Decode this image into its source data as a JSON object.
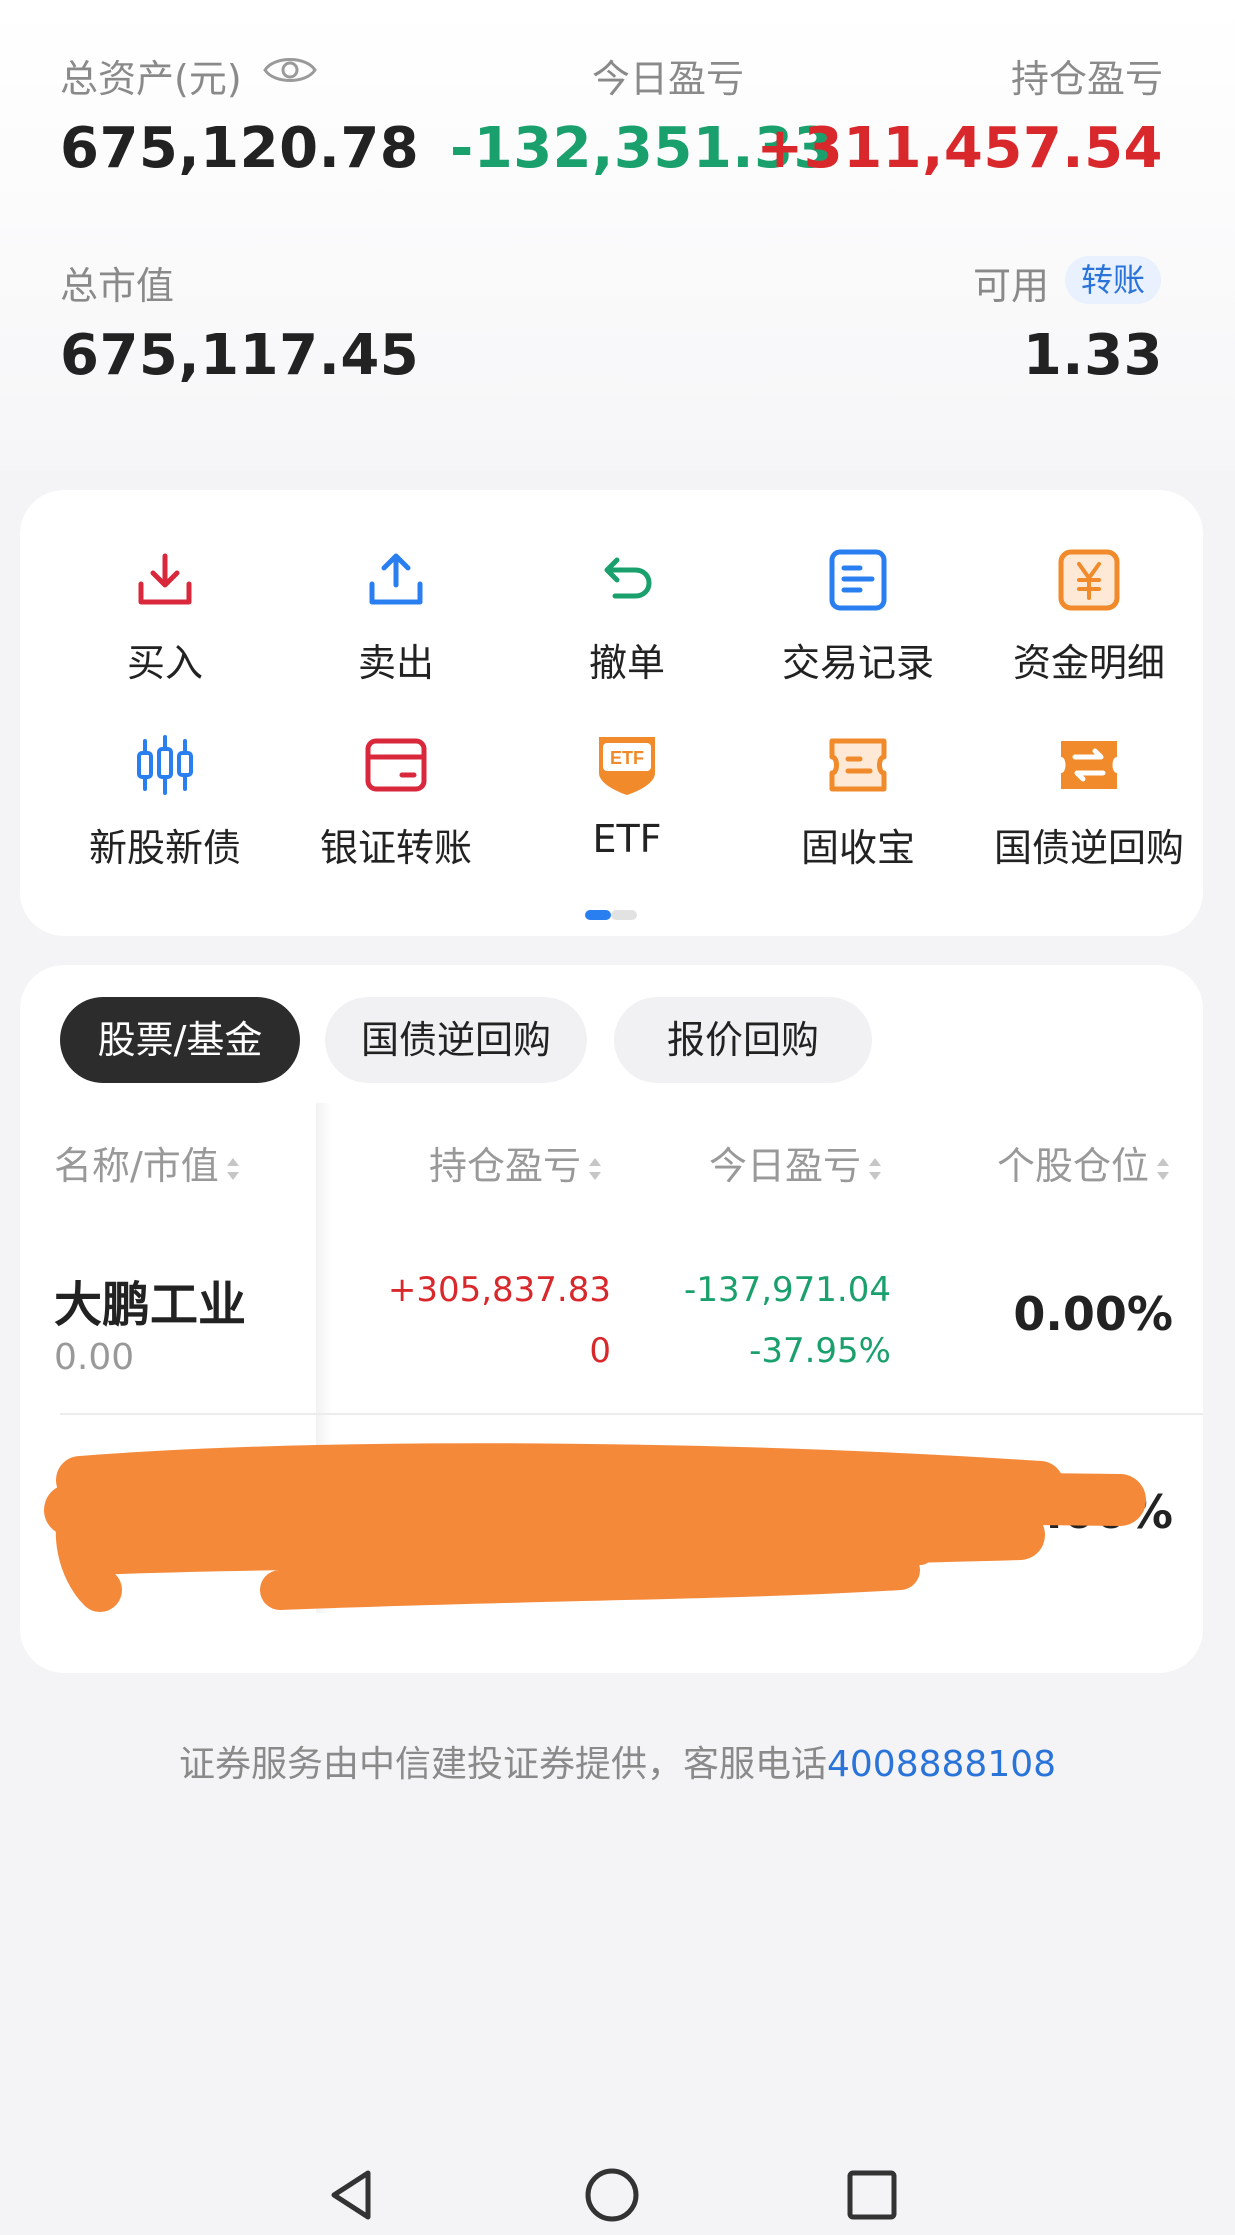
{
  "summary": {
    "total_assets_label": "总资产(元)",
    "total_assets_value": "675,120.78",
    "today_pl_label": "今日盈亏",
    "today_pl_value": "-132,351.33",
    "position_pl_label": "持仓盈亏",
    "position_pl_value": "+311,457.54",
    "market_value_label": "总市值",
    "market_value_value": "675,117.45",
    "available_label": "可用",
    "transfer_tag": "转账",
    "available_value": "1.33"
  },
  "actions": [
    {
      "label": "买入",
      "icon": "buy-download-icon",
      "color": "#d9283c"
    },
    {
      "label": "卖出",
      "icon": "sell-upload-icon",
      "color": "#2a7ff0"
    },
    {
      "label": "撤单",
      "icon": "undo-arrow-icon",
      "color": "#1aa06d"
    },
    {
      "label": "交易记录",
      "icon": "document-icon",
      "color": "#2a7ff0"
    },
    {
      "label": "资金明细",
      "icon": "yuan-icon",
      "color": "#f08a2a"
    },
    {
      "label": "新股新债",
      "icon": "candlestick-icon",
      "color": "#2a7ff0"
    },
    {
      "label": "银证转账",
      "icon": "card-icon",
      "color": "#d9283c"
    },
    {
      "label": "ETF",
      "icon": "etf-shield-icon",
      "color": "#f08a2a"
    },
    {
      "label": "固收宝",
      "icon": "ticket-icon",
      "color": "#f08a2a"
    },
    {
      "label": "国债逆回购",
      "icon": "exchange-icon",
      "color": "#f08a2a"
    }
  ],
  "tabs": [
    {
      "label": "股票/基金",
      "active": true
    },
    {
      "label": "国债逆回购",
      "active": false
    },
    {
      "label": "报价回购",
      "active": false
    }
  ],
  "table": {
    "headers": [
      "名称/市值",
      "持仓盈亏",
      "今日盈亏",
      "个股仓位"
    ],
    "rows": [
      {
        "name": "大鹏工业",
        "market_value": "0.00",
        "position_pl": "+305,837.83",
        "position_pl_pct": "0",
        "today_pl": "-137,971.04",
        "today_pl_pct": "-37.95%",
        "weight": "0.00%"
      },
      {
        "weight": "100.00%"
      }
    ]
  },
  "footer": {
    "text": "证券服务由中信建投证券提供，客服电话",
    "phone": "4008888108"
  },
  "colors": {
    "red": "#d9282c",
    "green": "#1aa06d",
    "blue": "#2a74d9",
    "orange": "#f5893a"
  }
}
